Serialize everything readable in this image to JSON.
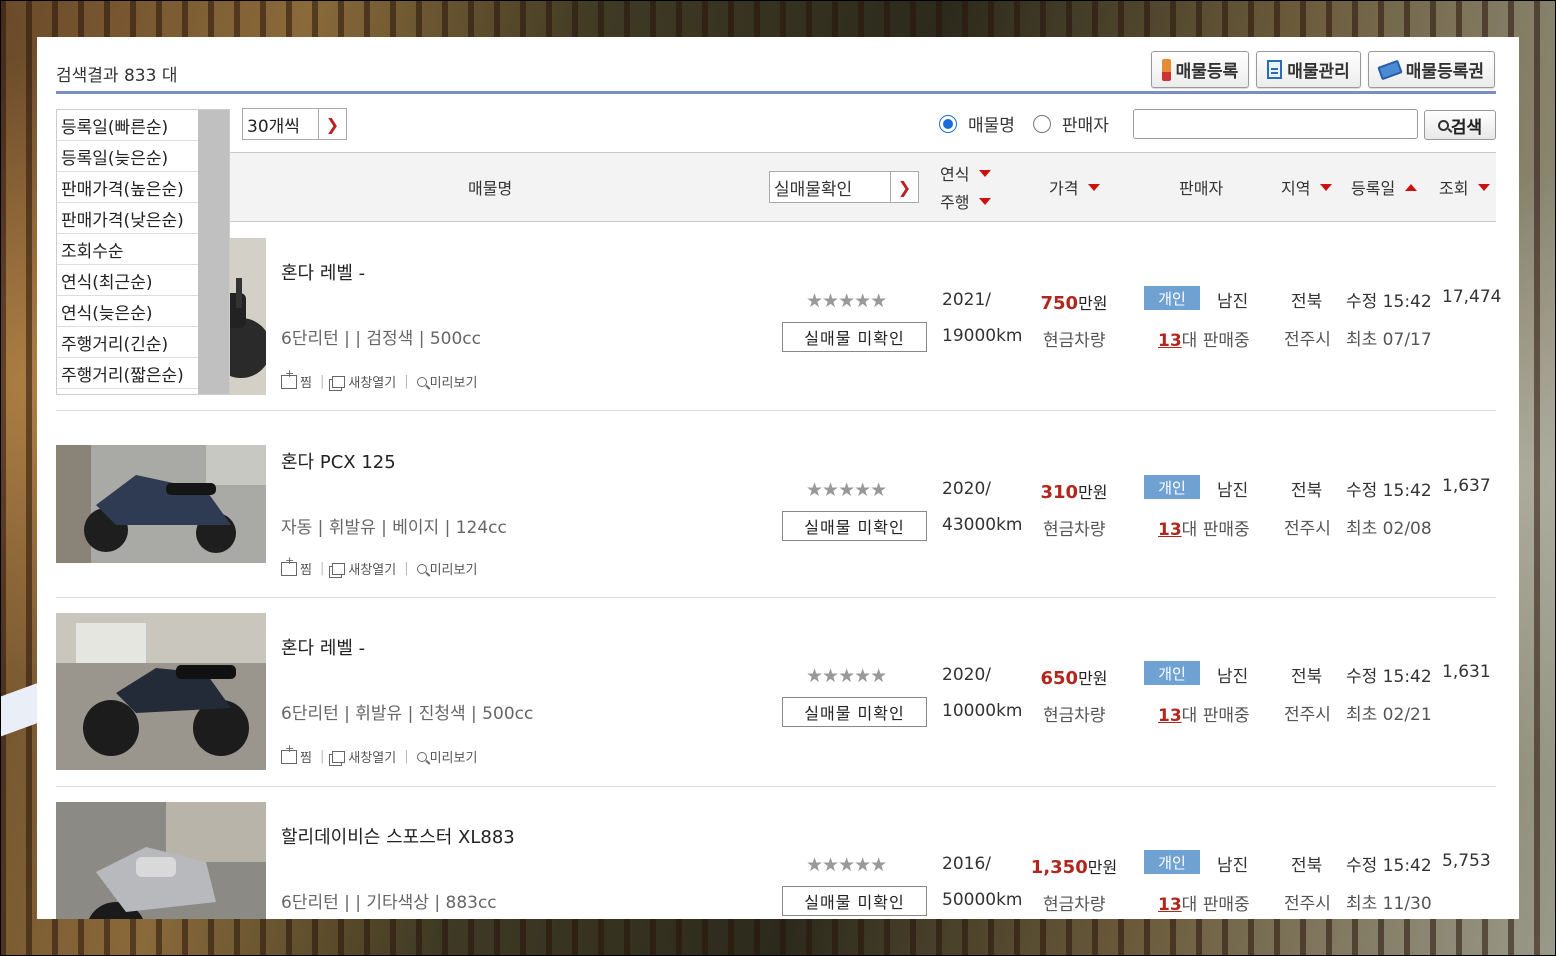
{
  "header": {
    "result_count_text": "검색결과 833 대",
    "buttons": [
      {
        "label": "매물등록",
        "icon": "pen-icon"
      },
      {
        "label": "매물관리",
        "icon": "document-icon"
      },
      {
        "label": "매물등록권",
        "icon": "ticket-icon"
      }
    ]
  },
  "controls": {
    "sort_options": [
      "등록일(빠른순)",
      "등록일(늦은순)",
      "판매가격(높은순)",
      "판매가격(낮은순)",
      "조회수순",
      "연식(최근순)",
      "연식(늦은순)",
      "주행거리(긴순)",
      "주행거리(짧은순)"
    ],
    "per_page": "30개씩",
    "radio_options": [
      "매물명",
      "판매자"
    ],
    "radio_selected": "매물명",
    "search_value": "",
    "search_button": "검색"
  },
  "table_header": {
    "name": "매물명",
    "real_check": "실매물확인",
    "year": "연식",
    "mileage": "주행",
    "price": "가격",
    "seller": "판매자",
    "region": "지역",
    "date": "등록일",
    "views": "조회"
  },
  "colors": {
    "accent_price": "#b3261e",
    "badge_bg": "#6fa2d3",
    "rule": "#7b8cc7"
  },
  "listings": [
    {
      "title": "혼다 레벨 -",
      "spec": "6단리턴 |  | 검정색 | 500cc",
      "actions": [
        "찜",
        "새창열기",
        "미리보기"
      ],
      "stars": "★★★★★",
      "real_button": "실매물 미확인",
      "year": "2021/",
      "mileage": "19000km",
      "price_num": "750",
      "price_unit": "만원",
      "payment": "현금차량",
      "seller_type": "개인",
      "seller_name": "남진",
      "selling_count": "13",
      "selling_suffix": "대 판매중",
      "region": "전북",
      "city": "전주시",
      "updated": "수정 15:42",
      "first": "최초 07/17",
      "views": "17,474"
    },
    {
      "title": "혼다 PCX 125",
      "spec": "자동 | 휘발유 | 베이지 | 124cc",
      "actions": [
        "찜",
        "새창열기",
        "미리보기"
      ],
      "stars": "★★★★★",
      "real_button": "실매물 미확인",
      "year": "2020/",
      "mileage": "43000km",
      "price_num": "310",
      "price_unit": "만원",
      "payment": "현금차량",
      "seller_type": "개인",
      "seller_name": "남진",
      "selling_count": "13",
      "selling_suffix": "대 판매중",
      "region": "전북",
      "city": "전주시",
      "updated": "수정 15:42",
      "first": "최초 02/08",
      "views": "1,637"
    },
    {
      "title": "혼다 레벨 -",
      "spec": "6단리턴 | 휘발유 | 진청색 | 500cc",
      "actions": [
        "찜",
        "새창열기",
        "미리보기"
      ],
      "stars": "★★★★★",
      "real_button": "실매물 미확인",
      "year": "2020/",
      "mileage": "10000km",
      "price_num": "650",
      "price_unit": "만원",
      "payment": "현금차량",
      "seller_type": "개인",
      "seller_name": "남진",
      "selling_count": "13",
      "selling_suffix": "대 판매중",
      "region": "전북",
      "city": "전주시",
      "updated": "수정 15:42",
      "first": "최초 02/21",
      "views": "1,631"
    },
    {
      "title": "할리데이비슨 스포스터 XL883",
      "spec": "6단리턴 |  | 기타색상 | 883cc",
      "actions": [
        "찜",
        "새창열기",
        "미리보기"
      ],
      "stars": "★★★★★",
      "real_button": "실매물 미확인",
      "year": "2016/",
      "mileage": "50000km",
      "price_num": "1,350",
      "price_unit": "만원",
      "payment": "현금차량",
      "seller_type": "개인",
      "seller_name": "남진",
      "selling_count": "13",
      "selling_suffix": "대 판매중",
      "region": "전북",
      "city": "전주시",
      "updated": "수정 15:42",
      "first": "최초 11/30",
      "views": "5,753"
    }
  ]
}
